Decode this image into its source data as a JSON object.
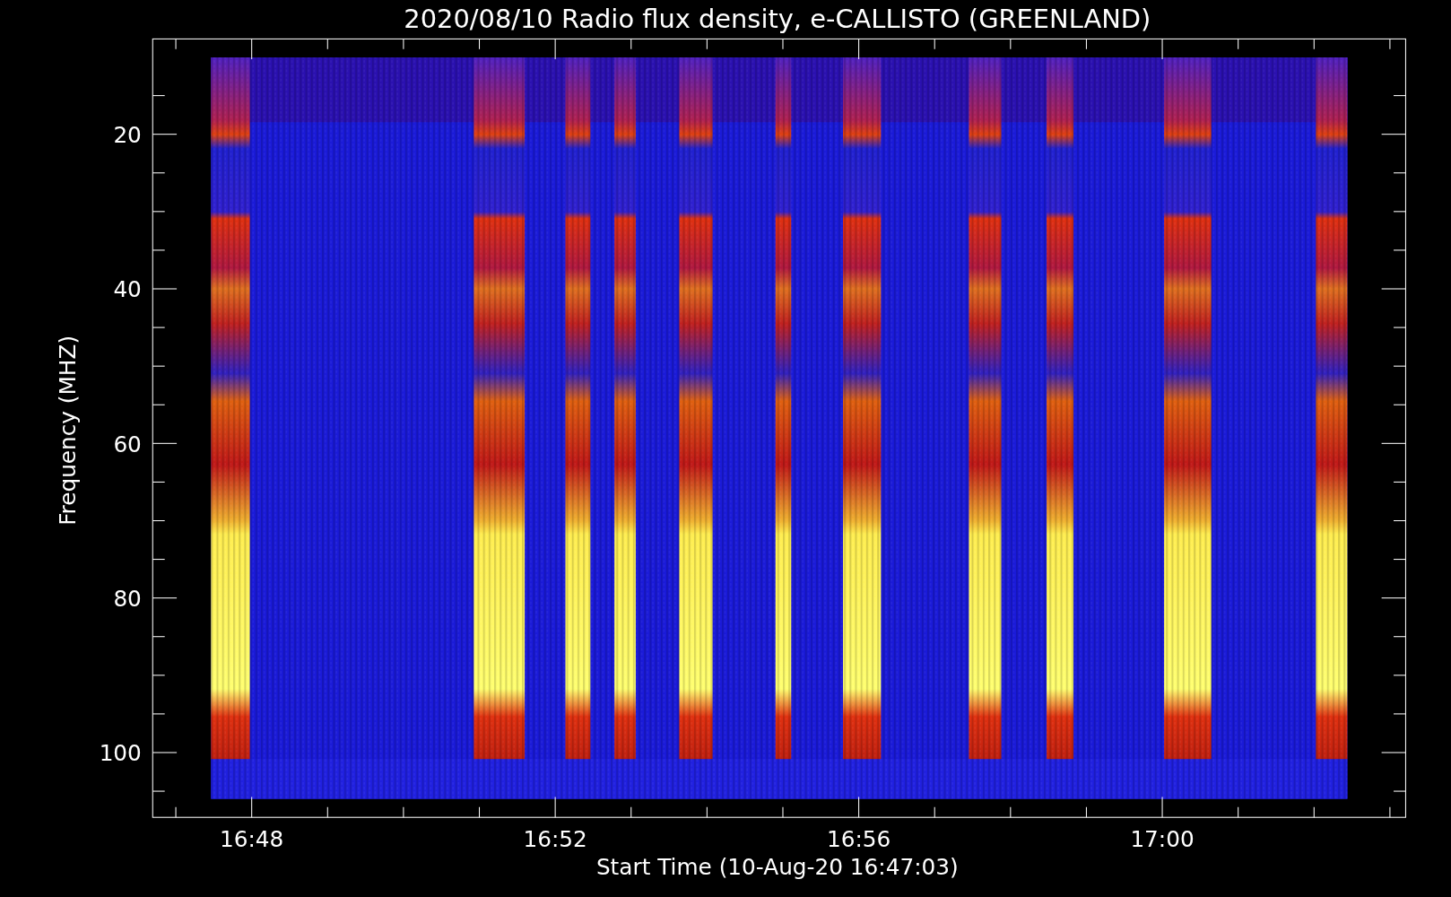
{
  "title": "2020/08/10  Radio flux density, e-CALLISTO (GREENLAND)",
  "y_axis": {
    "label": "Frequency (MHZ)",
    "ticks": [
      "20",
      "40",
      "60",
      "80",
      "100"
    ]
  },
  "x_axis": {
    "label": "Start Time (10-Aug-20 16:47:03)",
    "ticks": [
      "16:48",
      "16:52",
      "16:56",
      "17:00"
    ]
  }
}
